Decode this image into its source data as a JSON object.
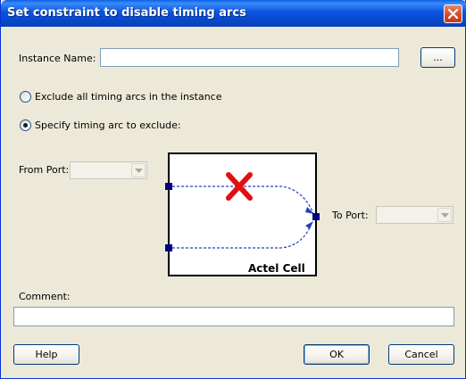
{
  "window": {
    "title": "Set constraint to disable timing arcs",
    "close_icon": "close-icon"
  },
  "instance": {
    "label": "Instance Name:",
    "value": "",
    "browse_label": "..."
  },
  "options": {
    "exclude_all_label": "Exclude all timing arcs in the instance",
    "specify_label": "Specify timing arc to exclude:",
    "selected": "specify"
  },
  "ports": {
    "from_label": "From Port:",
    "from_value": "",
    "to_label": "To Port:",
    "to_value": ""
  },
  "diagram": {
    "cell_label": "Actel Cell",
    "colors": {
      "arc": "#2040c0",
      "cross": "#e01010",
      "pin": "#000080"
    },
    "cross_icon": "red-x-icon"
  },
  "comment": {
    "label": "Comment:",
    "value": ""
  },
  "buttons": {
    "help": "Help",
    "ok": "OK",
    "cancel": "Cancel"
  }
}
